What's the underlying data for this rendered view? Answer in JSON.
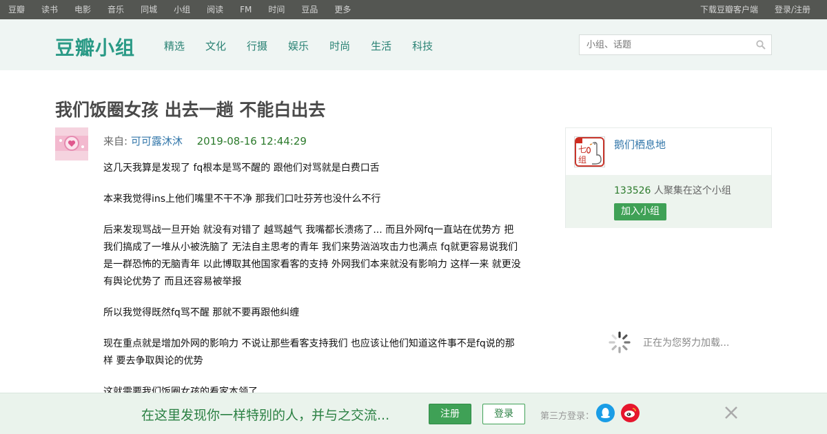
{
  "topbar": {
    "nav": [
      "豆瓣",
      "读书",
      "电影",
      "音乐",
      "同城",
      "小组",
      "阅读",
      "FM",
      "时间",
      "豆品",
      "更多"
    ],
    "download": "下载豆瓣客户端",
    "login": "登录/注册"
  },
  "header": {
    "logo": "豆瓣小组",
    "categories": [
      "精选",
      "文化",
      "行摄",
      "娱乐",
      "时尚",
      "生活",
      "科技"
    ],
    "search_placeholder": "小组、话题"
  },
  "post": {
    "title": "我们饭圈女孩 出去一趟 不能白出去",
    "from_label": "来自:",
    "author": "可可露沐沐",
    "time": "2019-08-16 12:44:29",
    "paragraphs": [
      "这几天我算是发现了 fq根本是骂不醒的 跟他们对骂就是白费口舌",
      "本来我觉得ins上他们嘴里不干不净 那我们口吐芬芳也没什么不行",
      "后来发现骂战一旦开始 就没有对错了 越骂越气  我嘴都长溃疡了... 而且外网fq一直站在优势方 把我们搞成了一堆从小被洗脑了 无法自主思考的青年  我们来势汹汹攻击力也满点 fq就更容易说我们是一群恐怖的无脑青年  以此博取其他国家看客的支持  外网我们本来就没有影响力  这样一来 就更没有舆论优势了  而且还容易被举报",
      "所以我觉得既然fq骂不醒  那就不要再跟他纠缠",
      "现在重点就是增加外网的影响力  不说让那些看客支持我们 也应该让他们知道这件事不是fq说的那样  要去争取舆论的优势",
      "这就需要我们饭圈女孩的看家本领了"
    ]
  },
  "group_card": {
    "name": "鹅们栖息地",
    "member_count": "133526",
    "member_suffix": " 人聚集在这个小组",
    "join_label": "加入小组"
  },
  "loading_text": "正在为您努力加载...",
  "promo": {
    "slogan": "在这里发现你一样特别的人，并与之交流...",
    "register": "注册",
    "login": "登录",
    "third_party": "第三方登录："
  }
}
